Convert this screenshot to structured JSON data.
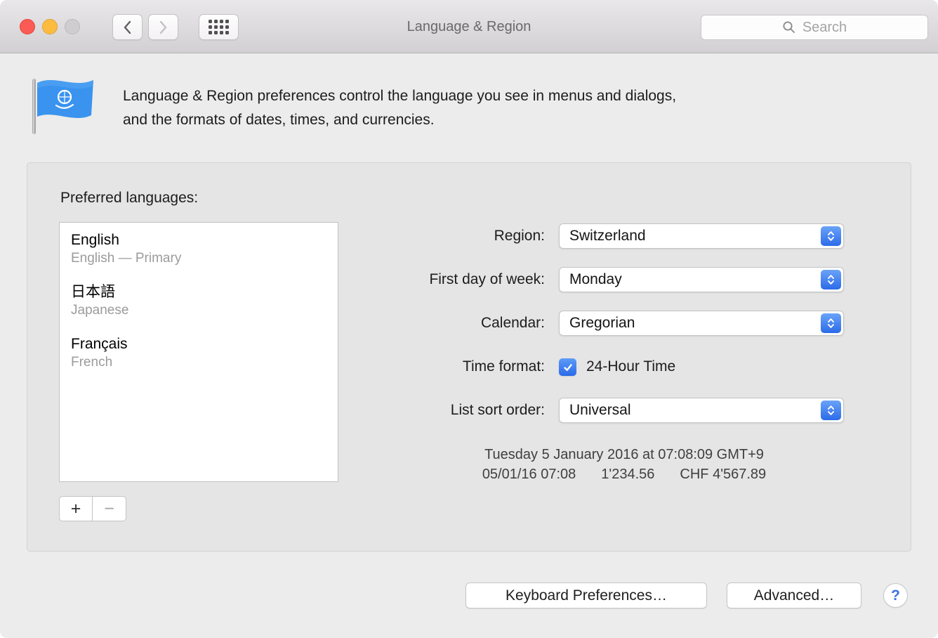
{
  "colors": {
    "accent_blue": "#2c6be8",
    "traffic_red": "#fc5a54",
    "traffic_yellow": "#fdbc40",
    "traffic_disabled": "#cfcdcf"
  },
  "titlebar": {
    "title": "Language & Region",
    "search_placeholder": "Search"
  },
  "header": {
    "description_line1": "Language & Region preferences control the language you see in menus and dialogs,",
    "description_line2": "and the formats of dates, times, and currencies."
  },
  "languages": {
    "label": "Preferred languages:",
    "items": [
      {
        "name": "English",
        "detail": "English — Primary"
      },
      {
        "name": "日本語",
        "detail": "Japanese"
      },
      {
        "name": "Français",
        "detail": "French"
      }
    ],
    "add": "+",
    "remove": "−"
  },
  "form": {
    "region": {
      "label": "Region:",
      "value": "Switzerland"
    },
    "first_day": {
      "label": "First day of week:",
      "value": "Monday"
    },
    "calendar": {
      "label": "Calendar:",
      "value": "Gregorian"
    },
    "time_format": {
      "label": "Time format:",
      "checkbox_label": "24-Hour Time",
      "checked": true
    },
    "sort_order": {
      "label": "List sort order:",
      "value": "Universal"
    }
  },
  "examples": {
    "full_date": "Tuesday 5 January 2016 at 07:08:09 GMT+9",
    "short_date": "05/01/16 07:08",
    "number": "1'234.56",
    "currency": "CHF 4'567.89"
  },
  "footer": {
    "keyboard_button": "Keyboard Preferences…",
    "advanced_button": "Advanced…",
    "help": "?"
  }
}
